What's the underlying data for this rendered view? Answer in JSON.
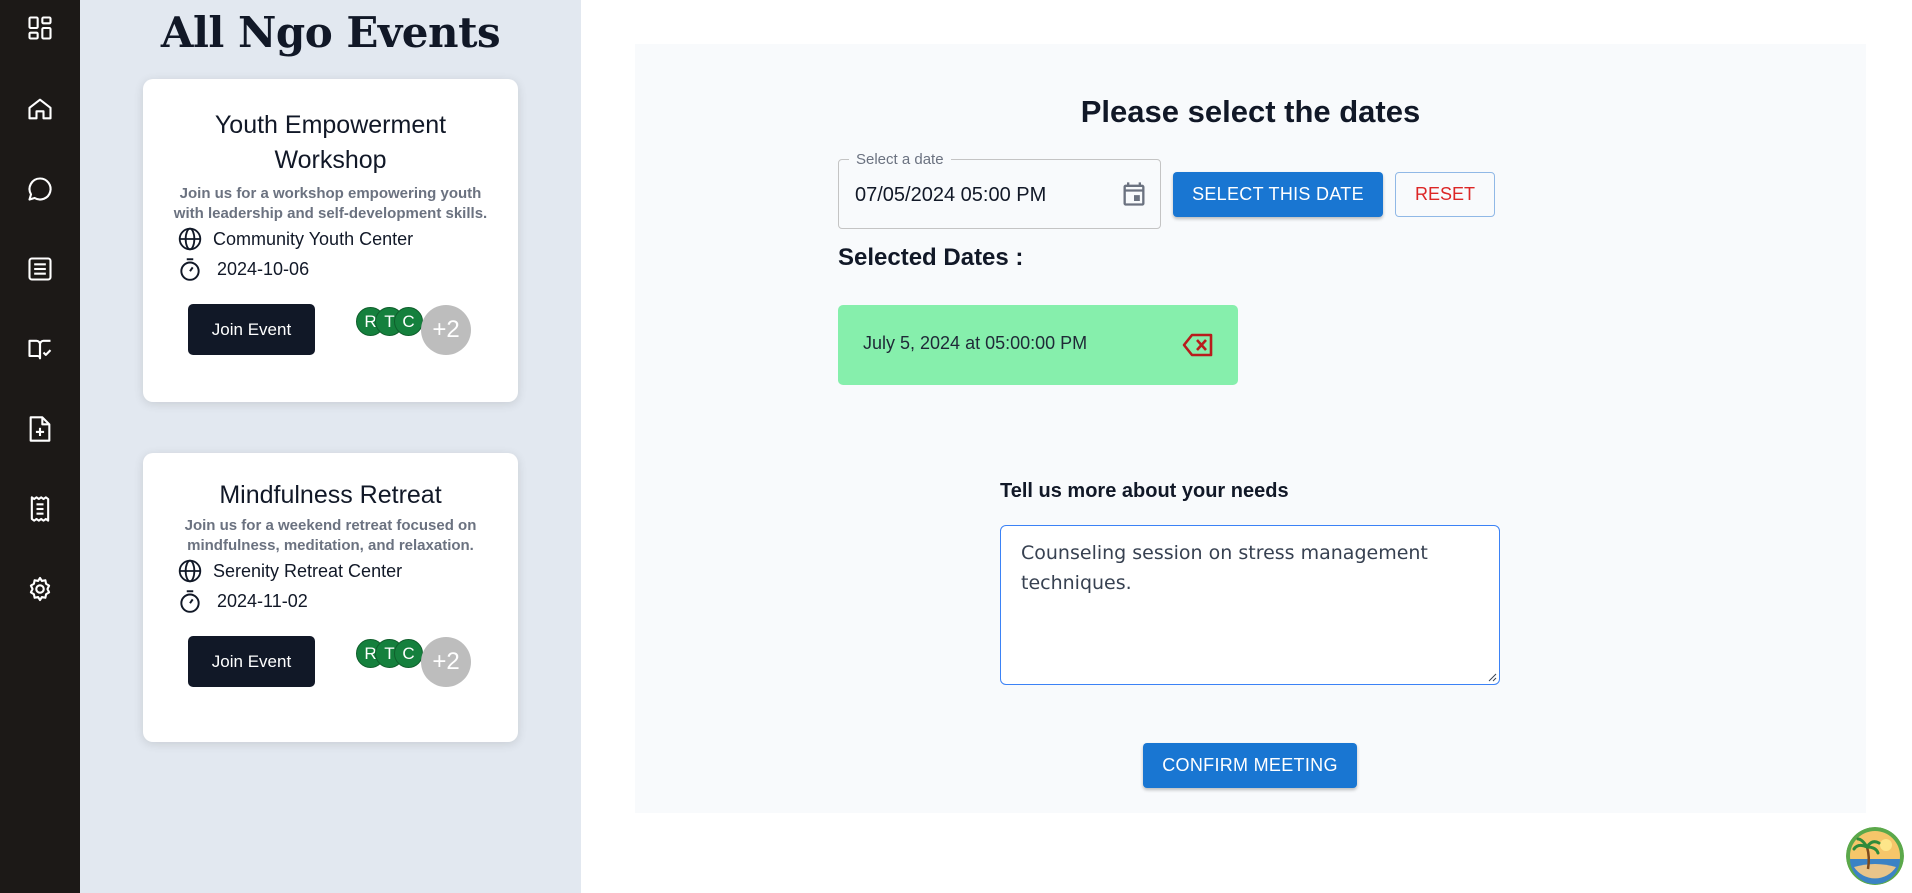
{
  "sidebar": {
    "icons": [
      "grid-icon",
      "home-icon",
      "chat-icon",
      "list-icon",
      "book-check-icon",
      "file-plus-icon",
      "receipt-icon",
      "gear-icon"
    ]
  },
  "events_panel": {
    "title": "All Ngo Events",
    "cards": [
      {
        "title": "Youth Empowerment Workshop",
        "description": "Join us for a workshop empowering youth with leadership and self-development skills.",
        "location": "Community Youth Center",
        "date": "2024-10-06",
        "join_label": "Join Event",
        "avatars": [
          "R",
          "T",
          "C"
        ],
        "more": "+2"
      },
      {
        "title": "Mindfulness Retreat",
        "description": "Join us for a weekend retreat focused on mindfulness, meditation, and relaxation.",
        "location": "Serenity Retreat Center",
        "date": "2024-11-02",
        "join_label": "Join Event",
        "avatars": [
          "R",
          "T",
          "C"
        ],
        "more": "+2"
      }
    ]
  },
  "scheduler": {
    "heading": "Please select the dates",
    "date_field_label": "Select a date",
    "date_field_value": "07/05/2024 05:00 PM",
    "select_button": "SELECT THIS DATE",
    "reset_button": "RESET",
    "selected_label": "Selected Dates :",
    "selected_dates": [
      "July 5, 2024 at 05:00:00 PM"
    ],
    "needs_label": "Tell us more about your needs",
    "needs_value": "Counseling session on stress management techniques.",
    "confirm_button": "CONFIRM MEETING"
  },
  "colors": {
    "rail": "#1c1917",
    "events_bg": "#e2e8f0",
    "primary": "#1976d2",
    "chip": "#86efac",
    "reset_text": "#dc2626",
    "avatar_green": "#15803d",
    "delete_icon": "#b91c1c"
  }
}
